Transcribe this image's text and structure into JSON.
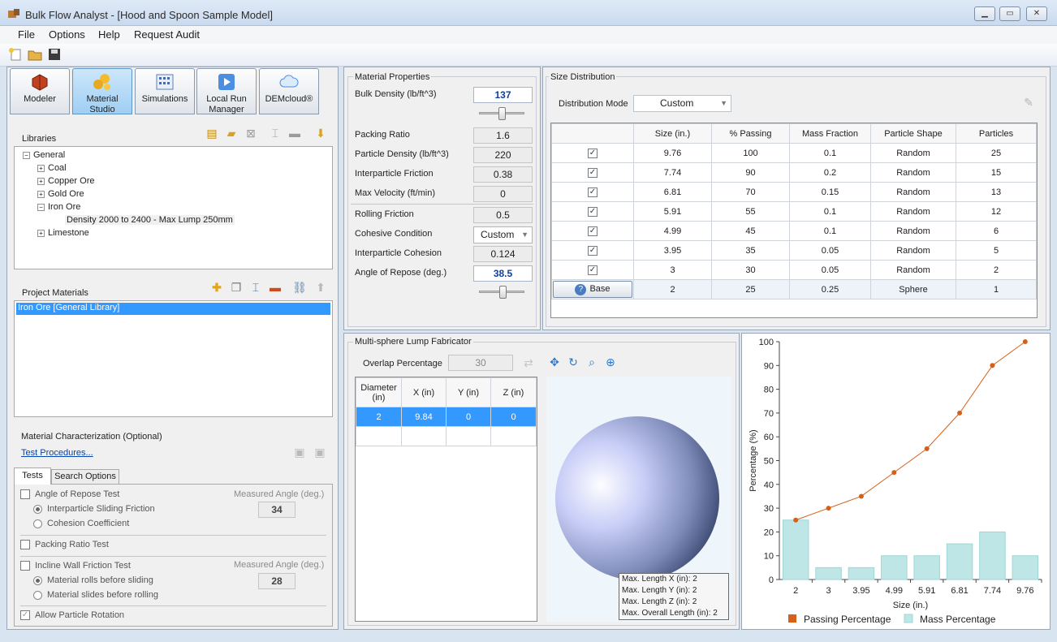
{
  "window": {
    "title": "Bulk Flow Analyst - [Hood and Spoon Sample Model]",
    "minimize": "▁",
    "maximize": "▭",
    "close": "✕"
  },
  "menu": [
    "File",
    "Options",
    "Help",
    "Request Audit"
  ],
  "toolbar_icons": [
    "new-file-icon",
    "open-folder-icon",
    "save-icon"
  ],
  "tabs": [
    {
      "label": "Modeler",
      "icon": "modeler-icon",
      "active": false
    },
    {
      "label": "Material Studio",
      "icon": "material-studio-icon",
      "active": true
    },
    {
      "label": "Simulations",
      "icon": "simulations-icon",
      "active": false
    },
    {
      "label": "Local Run Manager",
      "icon": "play-icon",
      "active": false
    },
    {
      "label": "DEMcloud®",
      "icon": "cloud-icon",
      "active": false
    }
  ],
  "libraries": {
    "title": "Libraries",
    "tree": {
      "root": "General",
      "items": [
        "Coal",
        "Copper Ore",
        "Gold Ore",
        "Iron Ore",
        "Limestone"
      ],
      "expanded_item": "Iron Ore",
      "child": "Density 2000 to 2400 - Max Lump 250mm"
    }
  },
  "project_materials": {
    "title": "Project Materials",
    "items": [
      "Iron Ore [General Library]"
    ]
  },
  "characterization": {
    "title": "Material Characterization (Optional)",
    "link": "Test Procedures...",
    "tabs": [
      "Tests",
      "Search Options"
    ],
    "angle_test": {
      "label": "Angle of Repose Test",
      "measured_label": "Measured Angle (deg.)",
      "value": "34",
      "options": [
        "Interparticle Sliding Friction",
        "Cohesion Coefficient"
      ]
    },
    "packing_test": {
      "label": "Packing Ratio Test"
    },
    "incline_test": {
      "label": "Incline Wall Friction Test",
      "measured_label": "Measured Angle (deg.)",
      "value": "28",
      "options": [
        "Material rolls before sliding",
        "Material slides before rolling"
      ]
    },
    "rotation": {
      "label": "Allow Particle Rotation"
    }
  },
  "material_properties": {
    "title": "Material Properties",
    "bulk_density": {
      "label": "Bulk Density (lb/ft^3)",
      "value": "137"
    },
    "packing_ratio": {
      "label": "Packing Ratio",
      "value": "1.6"
    },
    "particle_density": {
      "label": "Particle Density (lb/ft^3)",
      "value": "220"
    },
    "interparticle_friction": {
      "label": "Interparticle Friction",
      "value": "0.38"
    },
    "max_velocity": {
      "label": "Max Velocity (ft/min)",
      "value": "0"
    },
    "rolling_friction": {
      "label": "Rolling Friction",
      "value": "0.5"
    },
    "cohesive_condition": {
      "label": "Cohesive Condition",
      "value": "Custom"
    },
    "interparticle_cohesion": {
      "label": "Interparticle Cohesion",
      "value": "0.124"
    },
    "angle_of_repose": {
      "label": "Angle of Repose (deg.)",
      "value": "38.5"
    }
  },
  "size_distribution": {
    "title": "Size Distribution",
    "mode_label": "Distribution Mode",
    "mode_value": "Custom",
    "columns": [
      "",
      "Size (in.)",
      "% Passing",
      "Mass Fraction",
      "Particle Shape",
      "Particles"
    ],
    "rows": [
      {
        "check": "✓",
        "size": "9.76",
        "passing": "100",
        "mass": "0.1",
        "shape": "Random",
        "particles": "25"
      },
      {
        "check": "✓",
        "size": "7.74",
        "passing": "90",
        "mass": "0.2",
        "shape": "Random",
        "particles": "15"
      },
      {
        "check": "✓",
        "size": "6.81",
        "passing": "70",
        "mass": "0.15",
        "shape": "Random",
        "particles": "13"
      },
      {
        "check": "✓",
        "size": "5.91",
        "passing": "55",
        "mass": "0.1",
        "shape": "Random",
        "particles": "12"
      },
      {
        "check": "✓",
        "size": "4.99",
        "passing": "45",
        "mass": "0.1",
        "shape": "Random",
        "particles": "6"
      },
      {
        "check": "✓",
        "size": "3.95",
        "passing": "35",
        "mass": "0.05",
        "shape": "Random",
        "particles": "5"
      },
      {
        "check": "✓",
        "size": "3",
        "passing": "30",
        "mass": "0.05",
        "shape": "Random",
        "particles": "2"
      }
    ],
    "base_row": {
      "label": "Base",
      "size": "2",
      "passing": "25",
      "mass": "0.25",
      "shape": "Sphere",
      "particles": "1"
    }
  },
  "lump_fabricator": {
    "title": "Multi-sphere Lump Fabricator",
    "overlap_label": "Overlap Percentage",
    "overlap_value": "30",
    "columns": [
      "Diameter (in)",
      "X (in)",
      "Y (in)",
      "Z (in)"
    ],
    "rows": [
      {
        "diameter": "2",
        "x": "9.84",
        "y": "0",
        "z": "0"
      }
    ],
    "info": [
      "Max. Length X (in): 2",
      "Max. Length Y (in): 2",
      "Max. Length Z (in): 2",
      "Max. Overall Length (in): 2"
    ],
    "tools": [
      "move-icon",
      "rotate-icon",
      "zoom-icon",
      "zoom-extents-icon"
    ]
  },
  "chart_data": {
    "type": "bar",
    "categories": [
      "2",
      "3",
      "3.95",
      "4.99",
      "5.91",
      "6.81",
      "7.74",
      "9.76"
    ],
    "series": [
      {
        "name": "Passing Percentage",
        "kind": "line",
        "values": [
          25,
          30,
          35,
          45,
          55,
          70,
          90,
          100
        ],
        "color": "#d4601a"
      },
      {
        "name": "Mass Percentage",
        "kind": "bar",
        "values": [
          25,
          5,
          5,
          10,
          10,
          15,
          20,
          10
        ],
        "color": "#bfe6e6"
      }
    ],
    "title": "",
    "xlabel": "Size (in.)",
    "ylabel": "Percentage (%)",
    "ylim": [
      0,
      100
    ],
    "yticks": [
      "0",
      "10",
      "20",
      "30",
      "40",
      "50",
      "60",
      "70",
      "80",
      "90",
      "100"
    ],
    "legend": "bottom",
    "grid": false
  }
}
